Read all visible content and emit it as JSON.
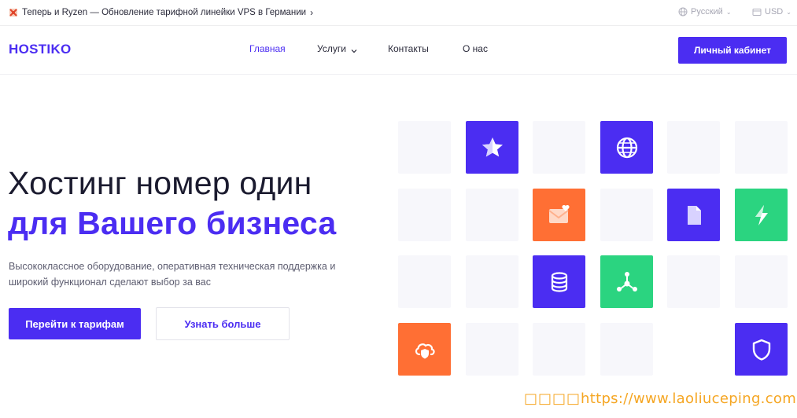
{
  "topbar": {
    "announcement": "Теперь и Ryzen — Обновление тарифной линейки VPS в Германии",
    "announcement_arrow": "›",
    "language": "Русский",
    "currency": "USD"
  },
  "nav": {
    "logo": "HOSTIKO",
    "items": [
      {
        "label": "Главная",
        "active": true
      },
      {
        "label": "Услуги",
        "has_dropdown": true
      },
      {
        "label": "Контакты"
      },
      {
        "label": "О нас"
      }
    ],
    "cabinet_button": "Личный кабинет"
  },
  "hero": {
    "title_line1": "Хостинг номер один",
    "title_line2": "для Вашего бизнеса",
    "subtitle": "Высококлассное оборудование, оперативная техническая поддержка и широкий функционал сделают выбор за вас",
    "primary_button": "Перейти к тарифам",
    "secondary_button": "Узнать больше"
  },
  "tiles": {
    "icons": [
      "star-icon",
      "globe-icon",
      "mail-heart-icon",
      "document-icon",
      "lightning-icon",
      "database-icon",
      "network-icon",
      "cloud-shield-icon",
      "shield-icon"
    ]
  },
  "colors": {
    "accent": "#4b2df2",
    "orange": "#ff6f34",
    "green": "#2bd480",
    "tile_empty": "#f7f7fb"
  },
  "watermark": {
    "boxes": "□□□□",
    "text": "https://www.laoliuceping.com"
  }
}
